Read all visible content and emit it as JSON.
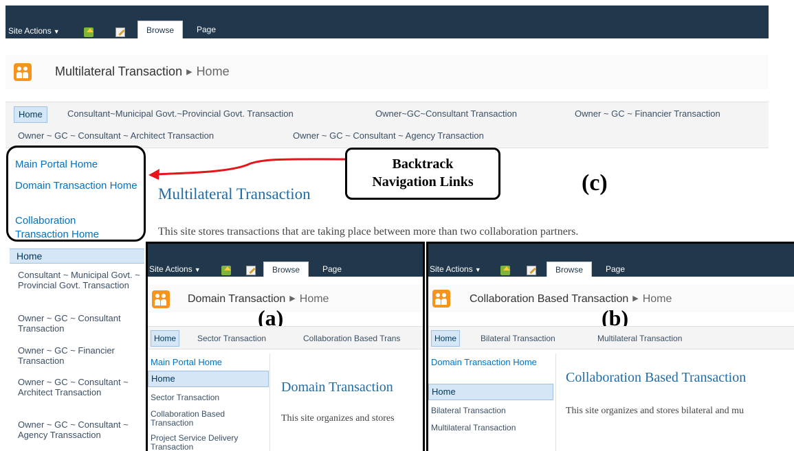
{
  "main": {
    "ribbon": {
      "site_actions": "Site Actions",
      "tab_browse": "Browse",
      "tab_page": "Page"
    },
    "title": {
      "site": "Multilateral Transaction",
      "current": "Home"
    },
    "top_nav": [
      "Home",
      "Consultant~Municipal Govt.~Provincial Govt. Transaction",
      "Owner~GC~Consultant Transaction",
      "Owner ~ GC ~ Financier Transaction",
      "Owner ~ GC ~ Consultant ~ Architect Transaction",
      "Owner ~ GC ~ Consultant ~ Agency Transaction"
    ],
    "backtrack_links": [
      "Main Portal Home",
      "Domain Transaction Home",
      "Collaboration Transaction Home"
    ],
    "quick_launch": [
      "Home",
      "Consultant ~ Municipal Govt. ~ Provincial Govt. Transaction",
      "Owner ~ GC ~ Consultant Transaction",
      "Owner ~ GC ~ Financier Transaction",
      "Owner ~ GC ~ Consultant ~ Architect Transaction",
      "Owner ~ GC ~ Consultant ~ Agency Transsaction"
    ],
    "page_heading": "Multilateral Transaction",
    "page_description": "This site stores transactions that are taking place between more than two collaboration partners."
  },
  "annotation": {
    "line1": "Backtrack",
    "line2": "Navigation Links",
    "label_c": "(c)",
    "label_a": "(a)",
    "label_b": "(b)",
    "arrow_color": "#e8141b"
  },
  "panel_a": {
    "ribbon": {
      "site_actions": "Site Actions",
      "tab_browse": "Browse",
      "tab_page": "Page"
    },
    "title": {
      "site": "Domain Transaction",
      "current": "Home"
    },
    "top_nav": [
      "Home",
      "Sector Transaction",
      "Collaboration Based Trans"
    ],
    "side_nav": [
      "Main Portal Home",
      "Home",
      "Sector Transaction",
      "Collaboration Based Transaction",
      "Project Service Delivery Transaction"
    ],
    "page_heading": "Domain Transaction",
    "page_description": "This site organizes and stores"
  },
  "panel_b": {
    "ribbon": {
      "site_actions": "Site Actions",
      "tab_browse": "Browse",
      "tab_page": "Page"
    },
    "title": {
      "site": "Collaboration Based Transaction",
      "current": "Home"
    },
    "top_nav": [
      "Home",
      "Bilateral Transaction",
      "Multilateral Transaction"
    ],
    "side_nav": [
      "Domain Transaction Home",
      "Home",
      "Bilateral Transaction",
      "Multilateral Transaction"
    ],
    "page_heading": "Collaboration Based Transaction",
    "page_description": "This site organizes and stores bilateral and mu"
  },
  "colors": {
    "ribbon": "#21374c",
    "link": "#0072c6",
    "nav_highlight": "#d5e6f7",
    "heading": "#1f6ba6"
  }
}
